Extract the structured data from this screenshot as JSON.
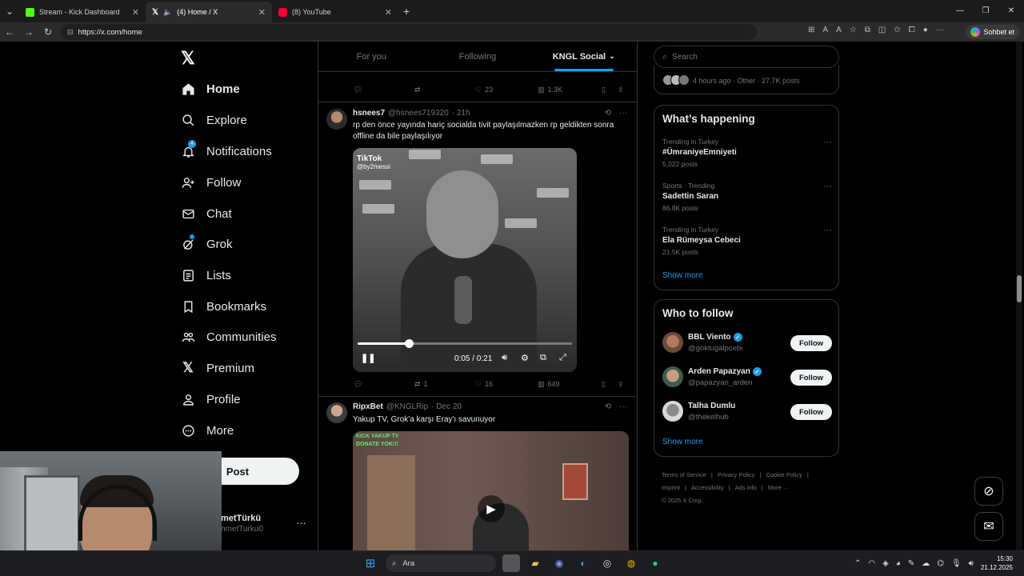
{
  "browser": {
    "tabs": [
      {
        "label": "Stream - Kick Dashboard",
        "color": "#53fc18"
      },
      {
        "label": "(4) Home / X",
        "color": "#ffffff"
      },
      {
        "label": "(8) YouTube",
        "color": "#ff0033"
      }
    ],
    "url": "https://x.com/home",
    "copilot_label": "Sohbet et"
  },
  "nav": {
    "items": [
      {
        "label": "Home",
        "icon": "home-icon"
      },
      {
        "label": "Explore",
        "icon": "search-icon"
      },
      {
        "label": "Notifications",
        "icon": "bell-icon",
        "badge": "4"
      },
      {
        "label": "Follow",
        "icon": "person-add-icon"
      },
      {
        "label": "Chat",
        "icon": "mail-icon"
      },
      {
        "label": "Grok",
        "icon": "grok-icon"
      },
      {
        "label": "Lists",
        "icon": "list-icon"
      },
      {
        "label": "Bookmarks",
        "icon": "bookmark-icon"
      },
      {
        "label": "Communities",
        "icon": "people-icon"
      },
      {
        "label": "Premium",
        "icon": "x-icon"
      },
      {
        "label": "Profile",
        "icon": "person-icon"
      },
      {
        "label": "More",
        "icon": "more-circle-icon"
      }
    ],
    "post_label": "Post",
    "account_name": "metTürkü",
    "account_handle": "nmetTurku0"
  },
  "timeline": {
    "tabs": [
      "For you",
      "Following",
      "KNGL Social"
    ],
    "prev_actions": {
      "replies": "",
      "reposts": "",
      "likes": "23",
      "views": "1.3K"
    },
    "tweet1": {
      "name": "hsnees7",
      "handle": "@hsnees719320",
      "time": "· 21h",
      "text": "rp den önce yayında hariç socialda tivit paylaşılmazken rp geldikten sonra offline da bile paylaşılıyor",
      "video": {
        "watermark": "TikTok",
        "watermark_user": "@by2messi",
        "time": "0:05 / 0:21",
        "progress": 0.24
      },
      "actions": {
        "replies": "",
        "reposts": "1",
        "likes": "16",
        "views": "649"
      }
    },
    "tweet2": {
      "name": "RipxBet",
      "handle": "@KNGLRip",
      "time": "· Dec 20",
      "text": "Yakup TV, Grok'a karşı Eray'ı savunuyor",
      "overlay": "KICK YAKUP TV\nDONATE YOK!!!"
    }
  },
  "right": {
    "search_placeholder": "Search",
    "top_meta": "4 hours ago · Other · 27.7K posts",
    "happening_title": "What’s happening",
    "trends": [
      {
        "category": "Trending in Turkey",
        "title": "#ÜmraniyeEmniyeti",
        "posts": "5,022 posts"
      },
      {
        "category": "Sports · Trending",
        "title": "Sadettin Saran",
        "posts": "86.8K posts"
      },
      {
        "category": "Trending in Turkey",
        "title": "Ela Rümeysa Cebeci",
        "posts": "21.5K posts"
      }
    ],
    "show_more": "Show more",
    "wtf_title": "Who to follow",
    "follow": [
      {
        "name": "BBL Viento",
        "handle": "@goktugalpcebi",
        "verified": true,
        "avatar_color": "#6b4a3a"
      },
      {
        "name": "Arden Papazyan",
        "handle": "@papazyan_arden",
        "verified": true,
        "avatar_color": "#3f5c4a"
      },
      {
        "name": "Talha Dumlu",
        "handle": "@thekelhub",
        "verified": false,
        "avatar_color": "#d9d9d9"
      }
    ],
    "follow_label": "Follow",
    "footer": [
      "Terms of Service",
      "|",
      "Privacy Policy",
      "|",
      "Cookie Policy",
      "|",
      "Imprint",
      "|",
      "Accessibility",
      "|",
      "Ads info",
      "|",
      "More ···",
      "© 2025 X Corp."
    ]
  },
  "taskbar": {
    "search_label": "Ara",
    "time": "15:30",
    "date": "21.12.2025"
  }
}
